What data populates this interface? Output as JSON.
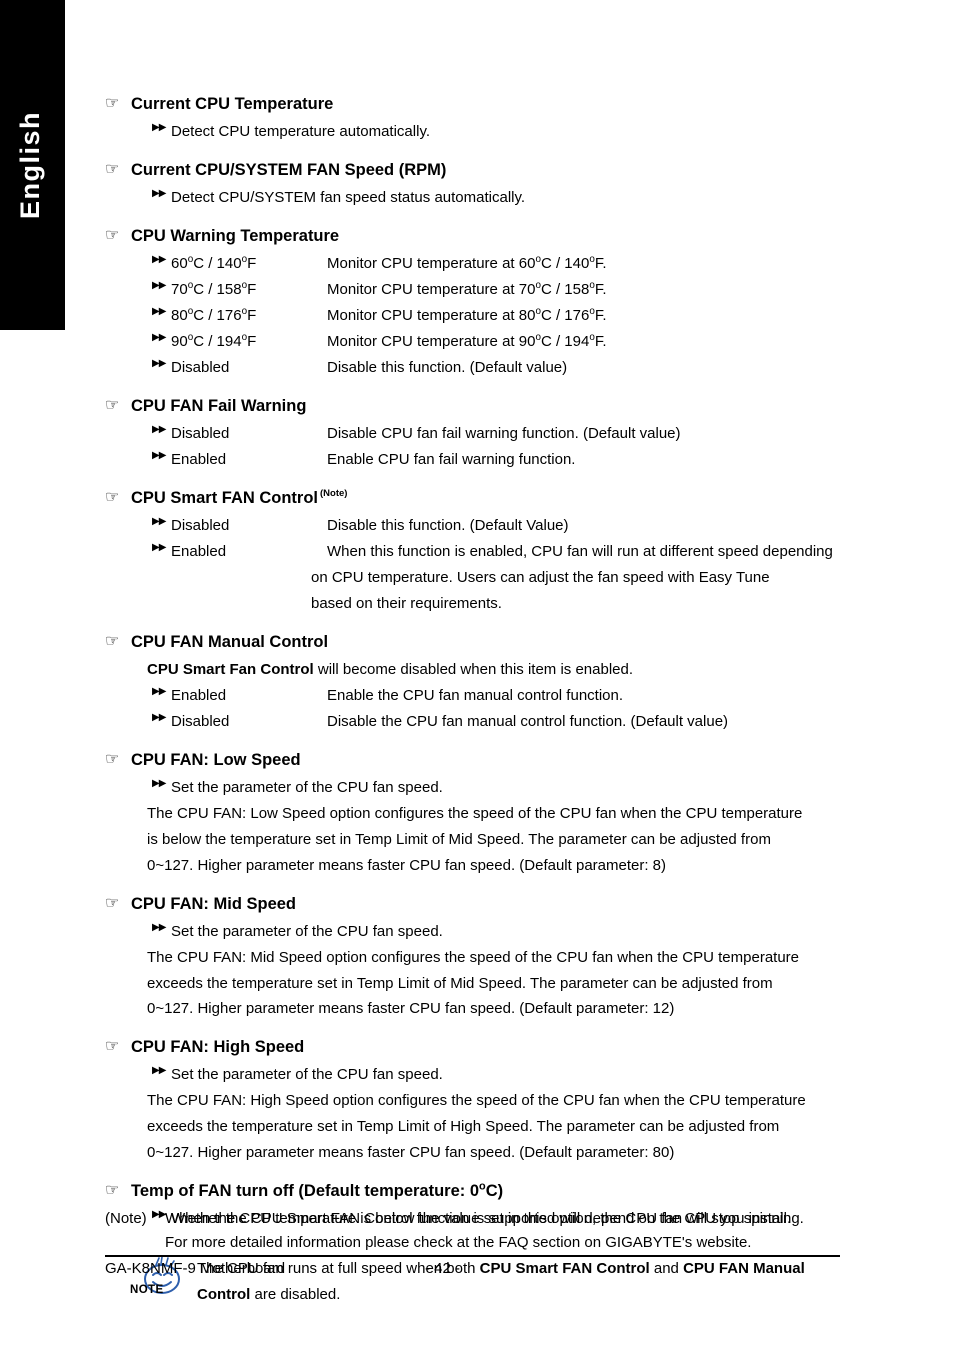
{
  "sidebar": {
    "language_label": "English"
  },
  "icons": {
    "hand": "☞",
    "arrow": "▶▶"
  },
  "sections": [
    {
      "id": "current-cpu-temperature",
      "heading": "Current CPU Temperature",
      "rows": [
        {
          "type": "note",
          "text": "Detect CPU temperature automatically."
        }
      ]
    },
    {
      "id": "current-cpu-system-fan-speed",
      "heading": "Current CPU/SYSTEM FAN Speed (RPM)",
      "rows": [
        {
          "type": "note",
          "text": "Detect CPU/SYSTEM fan speed status automatically."
        }
      ]
    },
    {
      "id": "cpu-warning-temperature",
      "heading": "CPU Warning Temperature",
      "rows": [
        {
          "type": "option",
          "label": "60oC / 140oF",
          "desc": "Monitor CPU temperature at 60oC / 140oF."
        },
        {
          "type": "option",
          "label": "70oC / 158oF",
          "desc": "Monitor CPU temperature at 70oC / 158oF."
        },
        {
          "type": "option",
          "label": "80oC / 176oF",
          "desc": "Monitor CPU temperature at 80oC / 176oF."
        },
        {
          "type": "option",
          "label": "90oC / 194oF",
          "desc": "Monitor CPU temperature at 90oC / 194oF."
        },
        {
          "type": "option",
          "label": "Disabled",
          "desc": "Disable this function. (Default value)"
        }
      ]
    },
    {
      "id": "cpu-fan-fail-warning",
      "heading": "CPU FAN Fail Warning",
      "rows": [
        {
          "type": "option",
          "label": "Disabled",
          "desc": "Disable CPU fan fail warning function. (Default value)"
        },
        {
          "type": "option",
          "label": "Enabled",
          "desc": "Enable CPU fan fail warning function."
        }
      ]
    },
    {
      "id": "cpu-smart-fan-control",
      "heading": "CPU Smart FAN Control",
      "heading_superscript": "(Note)",
      "rows": [
        {
          "type": "option",
          "label": "Disabled",
          "desc": "Disable this function. (Default Value)"
        },
        {
          "type": "option",
          "label": "Enabled",
          "desc": "When this function is enabled, CPU fan will run at different speed depending"
        },
        {
          "type": "cont",
          "text": "on CPU temperature. Users can adjust the fan speed with Easy Tune"
        },
        {
          "type": "cont",
          "text": "based on their requirements."
        }
      ]
    },
    {
      "id": "cpu-fan-manual-control",
      "heading": "CPU FAN Manual Control",
      "rows": [
        {
          "type": "para",
          "bold_lead": "CPU Smart Fan Control",
          "text": " will become disabled when this item is enabled."
        },
        {
          "type": "option",
          "label": "Enabled",
          "desc": "Enable the CPU fan manual control function."
        },
        {
          "type": "option",
          "label": "Disabled",
          "desc": "Disable the CPU fan manual control function. (Default value)"
        }
      ]
    },
    {
      "id": "cpu-fan-low-speed",
      "heading": "CPU FAN: Low Speed",
      "rows": [
        {
          "type": "note",
          "text": "Set the parameter of the CPU fan speed."
        },
        {
          "type": "para",
          "text": "The CPU FAN: Low Speed option configures the speed of the CPU fan when the CPU temperature"
        },
        {
          "type": "para",
          "text": "is below the temperature set in Temp Limit of Mid Speed. The parameter can be adjusted from"
        },
        {
          "type": "para",
          "text": "0~127. Higher parameter means faster CPU fan speed. (Default parameter: 8)"
        }
      ]
    },
    {
      "id": "cpu-fan-mid-speed",
      "heading": "CPU FAN: Mid Speed",
      "rows": [
        {
          "type": "note",
          "text": "Set the parameter of the CPU fan speed."
        },
        {
          "type": "para",
          "text": "The CPU FAN: Mid Speed option configures the speed of the CPU fan when the CPU temperature"
        },
        {
          "type": "para",
          "text": "exceeds the temperature set in Temp Limit of Mid Speed. The parameter can be adjusted from"
        },
        {
          "type": "para",
          "text": "0~127. Higher parameter means faster CPU fan speed. (Default parameter: 12)"
        }
      ]
    },
    {
      "id": "cpu-fan-high-speed",
      "heading": "CPU FAN: High Speed",
      "rows": [
        {
          "type": "note",
          "text": "Set the parameter of the CPU fan speed."
        },
        {
          "type": "para",
          "text": "The CPU FAN: High Speed option configures the speed of the CPU fan when the CPU temperature"
        },
        {
          "type": "para",
          "text": "exceeds the temperature set in Temp Limit of High Speed. The parameter can be adjusted from"
        },
        {
          "type": "para",
          "text": "0~127. Higher parameter means faster CPU fan speed. (Default parameter: 80)"
        }
      ]
    },
    {
      "id": "temp-of-fan-turn-off",
      "heading": "Temp of FAN turn off (Default temperature: 0oC)",
      "rows": [
        {
          "type": "note",
          "text": "When the CPU temperature is below the value set in this option, the CPU fan will stop spinning."
        }
      ]
    }
  ],
  "note_callout": {
    "icon_label": "NOTE",
    "icon_color": "#2E5FAC",
    "line1_pre": "The CPU fan runs at full speed when both ",
    "line1_bold1": "CPU Smart FAN Control",
    "line1_mid": " and ",
    "line1_bold2": "CPU FAN Manual",
    "line2_bold": "Control",
    "line2_post": " are disabled."
  },
  "footnote": {
    "marker": "(Note)",
    "line1": "Whether the CPU Smart FAN Control function is supported will depend on the CPU you install.",
    "line2": "For more detailed information please check at the FAQ section on GIGABYTE's website."
  },
  "footer": {
    "left": "GA-K8NMF-9 Motherboard",
    "page": "- 42 -"
  }
}
